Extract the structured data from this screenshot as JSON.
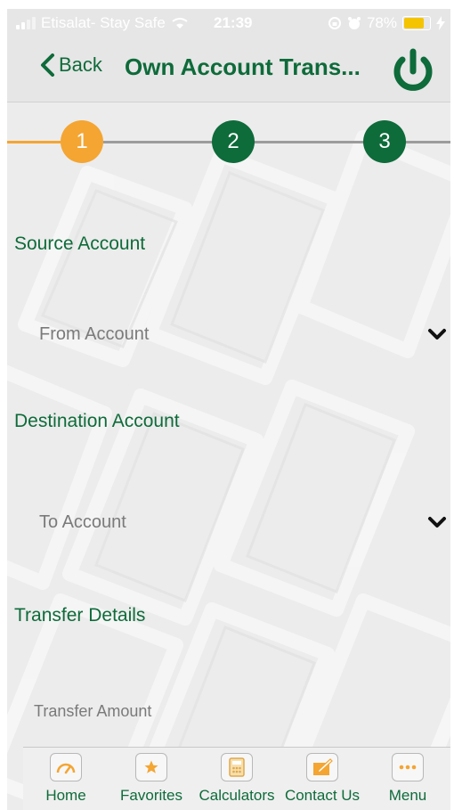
{
  "status_bar": {
    "carrier": "Etisalat- Stay Safe",
    "time": "21:39",
    "battery": "78%",
    "battery_level": 0.78
  },
  "header": {
    "back_label": "Back",
    "title": "Own Account Trans..."
  },
  "stepper": {
    "steps": [
      "1",
      "2",
      "3"
    ],
    "active_index": 0,
    "active_color": "#f4a532",
    "inactive_color": "#0e6b3a"
  },
  "form": {
    "source_heading": "Source Account",
    "from_account": "From Account",
    "destination_heading": "Destination Account",
    "to_account": "To Account",
    "details_heading": "Transfer Details",
    "amount_placeholder": "Transfer Amount"
  },
  "tabs": [
    {
      "label": "Home",
      "icon": "speedometer-icon"
    },
    {
      "label": "Favorites",
      "icon": "star-icon"
    },
    {
      "label": "Calculators",
      "icon": "calculator-icon"
    },
    {
      "label": "Contact Us",
      "icon": "compose-icon"
    },
    {
      "label": "Menu",
      "icon": "more-icon"
    }
  ],
  "colors": {
    "brand_green": "#0e6b3a",
    "accent_orange": "#f4a532"
  }
}
